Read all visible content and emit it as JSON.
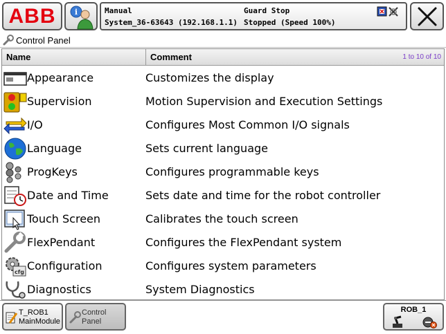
{
  "topbar": {
    "logo": "ABB",
    "status": {
      "mode": "Manual",
      "system": "System_36-63643 (192.168.1.1)",
      "guard": "Guard Stop",
      "state": "Stopped (Speed 100%)"
    }
  },
  "panel": {
    "title": "Control Panel"
  },
  "table": {
    "header_name": "Name",
    "header_comment": "Comment",
    "range": "1 to 10 of 10",
    "rows": [
      {
        "name": "Appearance",
        "comment": "Customizes the display",
        "icon": "display-icon"
      },
      {
        "name": "Supervision",
        "comment": "Motion Supervision and Execution Settings",
        "icon": "traffic-light-icon"
      },
      {
        "name": "I/O",
        "comment": "Configures Most Common I/O signals",
        "icon": "io-arrows-icon"
      },
      {
        "name": "Language",
        "comment": "Sets current language",
        "icon": "globe-icon"
      },
      {
        "name": "ProgKeys",
        "comment": "Configures programmable keys",
        "icon": "keys-icon"
      },
      {
        "name": "Date and Time",
        "comment": "Sets date and time for the robot controller",
        "icon": "calendar-clock-icon"
      },
      {
        "name": "Touch Screen",
        "comment": "Calibrates the touch screen",
        "icon": "touch-screen-icon"
      },
      {
        "name": "FlexPendant",
        "comment": "Configures the FlexPendant system",
        "icon": "wrench-icon"
      },
      {
        "name": "Configuration",
        "comment": "Configures system parameters",
        "icon": "gear-icon"
      },
      {
        "name": "Diagnostics",
        "comment": "System Diagnostics",
        "icon": "stethoscope-icon"
      }
    ]
  },
  "taskbar": {
    "task1_line1": "T_ROB1",
    "task1_line2": "MainModule",
    "task2_line1": "Control",
    "task2_line2": "Panel",
    "robot": "ROB_1"
  },
  "colors": {
    "abb_red": "#e4000f",
    "range_text": "#7a3cc8"
  }
}
